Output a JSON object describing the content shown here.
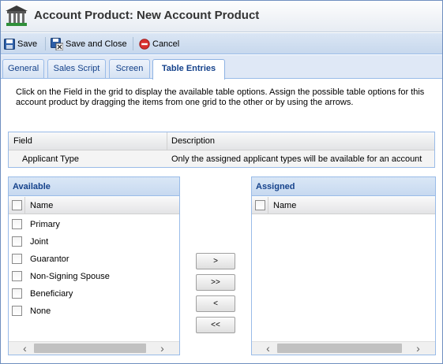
{
  "window": {
    "title": "Account Product: New Account Product",
    "icon": "bank-building-icon"
  },
  "toolbar": {
    "save_label": "Save",
    "save_close_label": "Save and Close",
    "cancel_label": "Cancel"
  },
  "tabs": [
    {
      "label": "General"
    },
    {
      "label": "Sales Script"
    },
    {
      "label": "Screen"
    },
    {
      "label": "Table Entries",
      "active": true
    }
  ],
  "instructions": "Click on the Field in the grid to display the available table options. Assign the possible table options for this account product by dragging the items from one grid to the other or by using the arrows.",
  "field_grid": {
    "columns": [
      "Field",
      "Description"
    ],
    "rows": [
      {
        "field": "Applicant Type",
        "description": "Only the assigned applicant types will be available for an account"
      }
    ]
  },
  "available": {
    "title": "Available",
    "column": "Name",
    "items": [
      "Primary",
      "Joint",
      "Guarantor",
      "Non-Signing Spouse",
      "Beneficiary",
      "None"
    ]
  },
  "assigned": {
    "title": "Assigned",
    "column": "Name",
    "items": []
  },
  "move_buttons": {
    "add": ">",
    "add_all": ">>",
    "remove": "<",
    "remove_all": "<<"
  },
  "colors": {
    "accent": "#15428b",
    "border": "#99bbe8",
    "cancel_red": "#d9302f"
  }
}
